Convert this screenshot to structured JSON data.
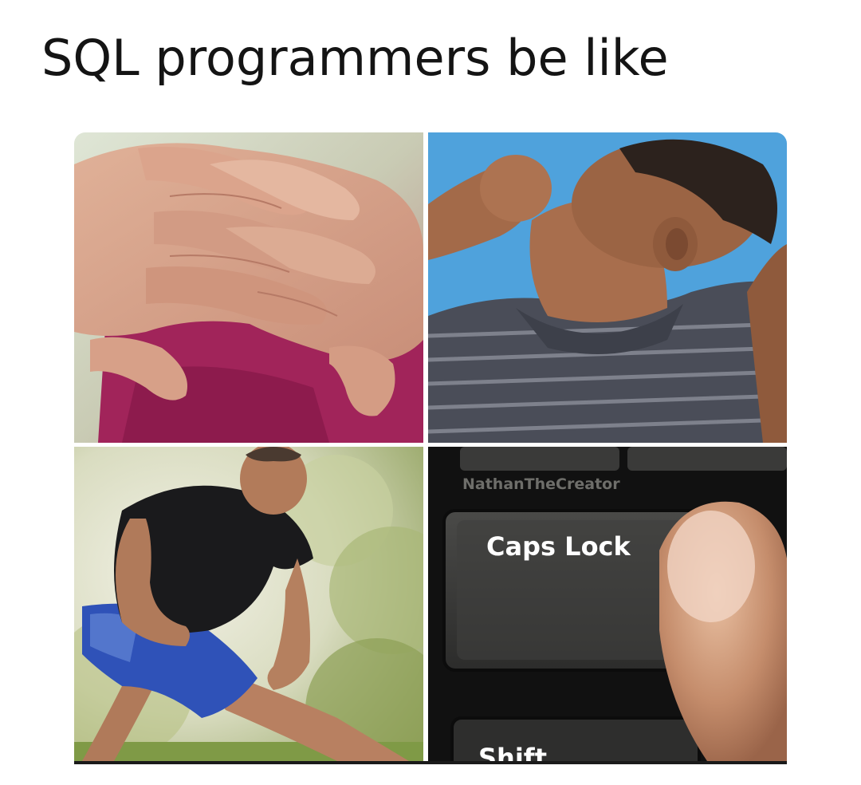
{
  "meme": {
    "title": "SQL programmers be like"
  },
  "panels": {
    "keyboard": {
      "watermark": "NathanTheCreator",
      "key_label": "Caps Lock",
      "partial_key_label": "Shift"
    }
  }
}
